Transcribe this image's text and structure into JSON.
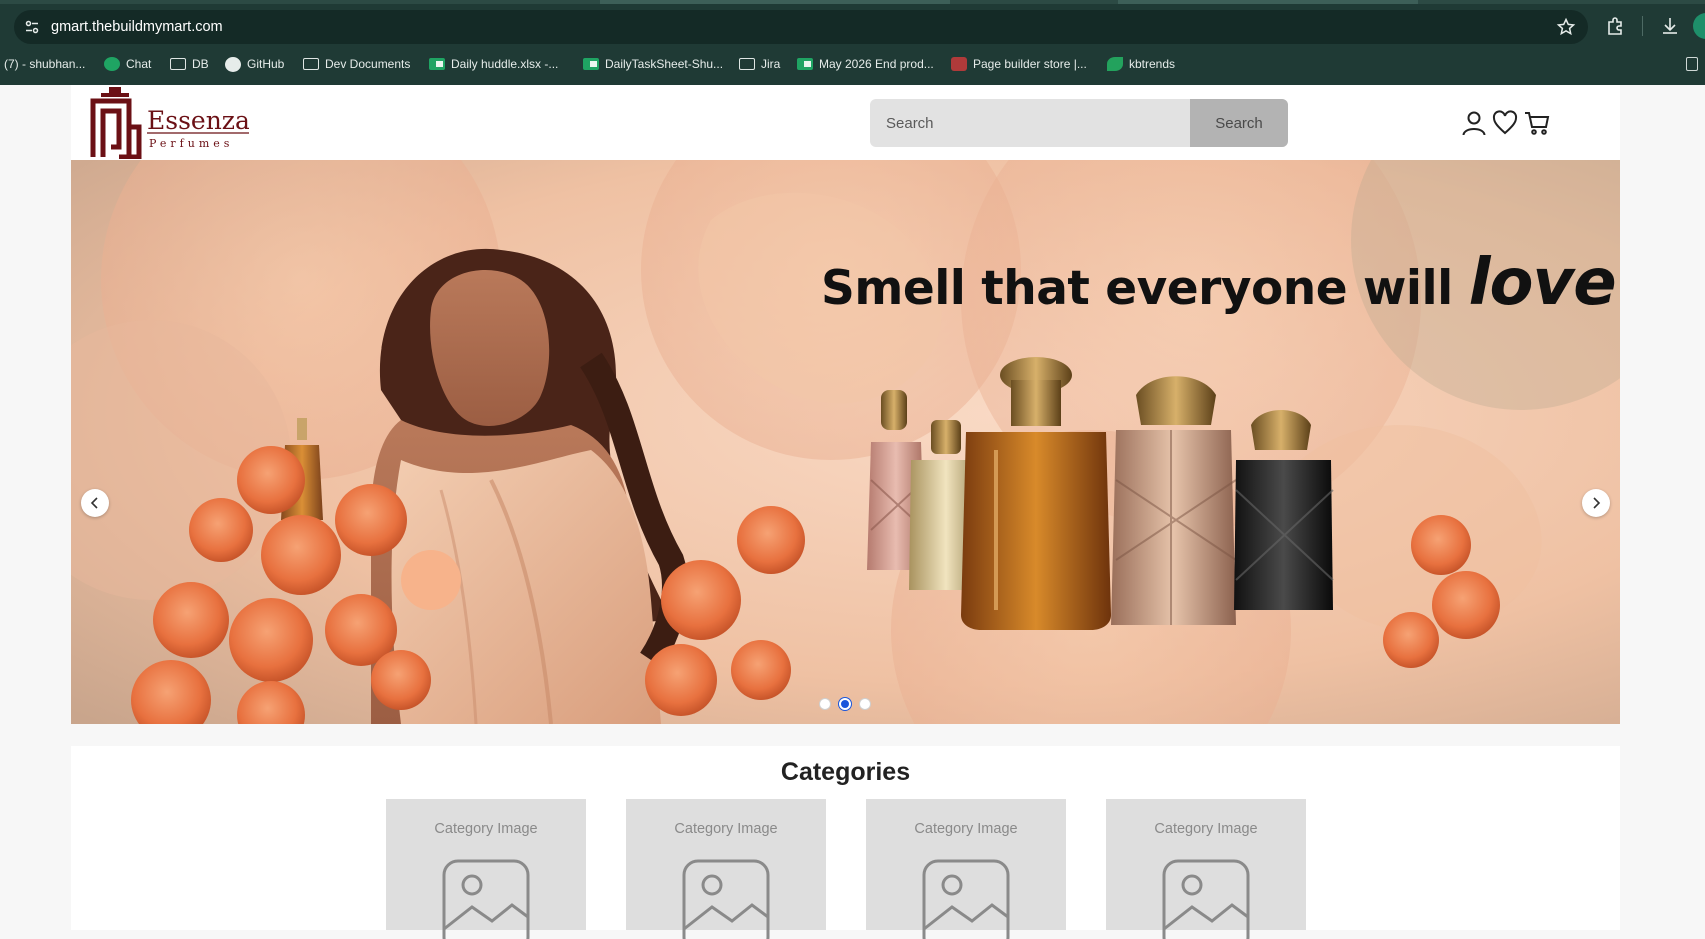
{
  "browser": {
    "url": "gmart.thebuildmymart.com",
    "bookmarks": [
      {
        "label": "(7) - shubhan...",
        "icon": "tab-icon"
      },
      {
        "label": "Chat",
        "icon": "chat-icon"
      },
      {
        "label": "DB",
        "icon": "folder-icon"
      },
      {
        "label": "GitHub",
        "icon": "github-icon"
      },
      {
        "label": "Dev Documents",
        "icon": "folder-icon"
      },
      {
        "label": "Daily huddle.xlsx -...",
        "icon": "sheets-icon"
      },
      {
        "label": "DailyTaskSheet-Shu...",
        "icon": "sheets-icon"
      },
      {
        "label": "Jira",
        "icon": "folder-icon"
      },
      {
        "label": "May 2026 End prod...",
        "icon": "sheets-icon"
      },
      {
        "label": "Page builder store |...",
        "icon": "site-icon"
      },
      {
        "label": "kbtrends",
        "icon": "leaf-icon"
      }
    ]
  },
  "header": {
    "logo_text": "Essenza",
    "logo_subtext": "Perfumes",
    "search_placeholder": "Search",
    "search_button": "Search"
  },
  "hero": {
    "headline_regular": "Smell that everyone will ",
    "headline_italic": "love",
    "slide_count": 3,
    "active_slide": 2
  },
  "categories": {
    "title": "Categories",
    "items": [
      {
        "label": "Category Image"
      },
      {
        "label": "Category Image"
      },
      {
        "label": "Category Image"
      },
      {
        "label": "Category Image"
      }
    ]
  },
  "colors": {
    "chrome_bg": "#1f3a35",
    "logo_maroon": "#6b1015",
    "active_dot": "#1a56db"
  }
}
